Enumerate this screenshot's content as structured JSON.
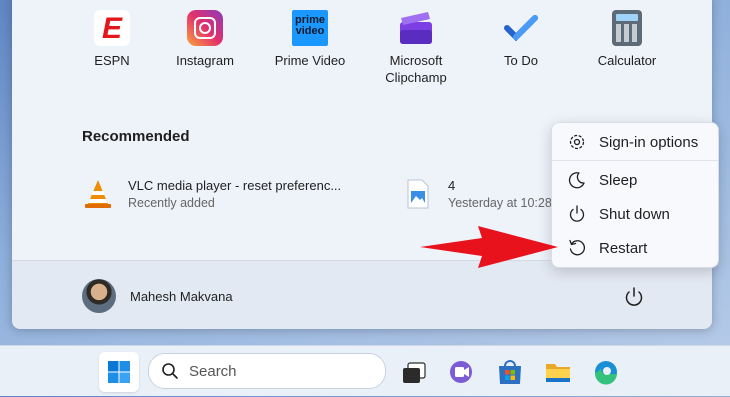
{
  "apps": [
    {
      "label": "ESPN",
      "icon": "espn-icon"
    },
    {
      "label": "Instagram",
      "icon": "instagram-icon"
    },
    {
      "label": "Prime Video",
      "icon": "prime-video-icon",
      "icon_text_1": "prime",
      "icon_text_2": "video"
    },
    {
      "label": "Microsoft\nClipchamp",
      "label_line1": "Microsoft",
      "label_line2": "Clipchamp",
      "icon": "clipchamp-icon"
    },
    {
      "label": "To Do",
      "icon": "todo-icon"
    },
    {
      "label": "Calculator",
      "icon": "calculator-icon"
    }
  ],
  "espn_icon_text": "E",
  "recommended": {
    "title": "Recommended",
    "items": [
      {
        "name": "VLC media player - reset preferenc...",
        "sub": "Recently added",
        "icon": "vlc-icon"
      },
      {
        "name": "4",
        "sub": "Yesterday at 10:28",
        "icon": "image-file-icon"
      }
    ]
  },
  "user": {
    "name": "Mahesh Makvana"
  },
  "power_menu": {
    "items": [
      {
        "label": "Sign-in options",
        "icon": "gear-icon"
      },
      {
        "label": "Sleep",
        "icon": "moon-icon"
      },
      {
        "label": "Shut down",
        "icon": "power-icon"
      },
      {
        "label": "Restart",
        "icon": "restart-icon"
      }
    ]
  },
  "taskbar": {
    "search_label": "Search",
    "items": [
      "start-icon",
      "task-view-icon",
      "teams-chat-icon",
      "store-icon",
      "file-explorer-icon",
      "edge-icon"
    ]
  },
  "colors": {
    "arrow": "#e8121c",
    "espn": "#e3161b",
    "accent": "#0067c0"
  }
}
